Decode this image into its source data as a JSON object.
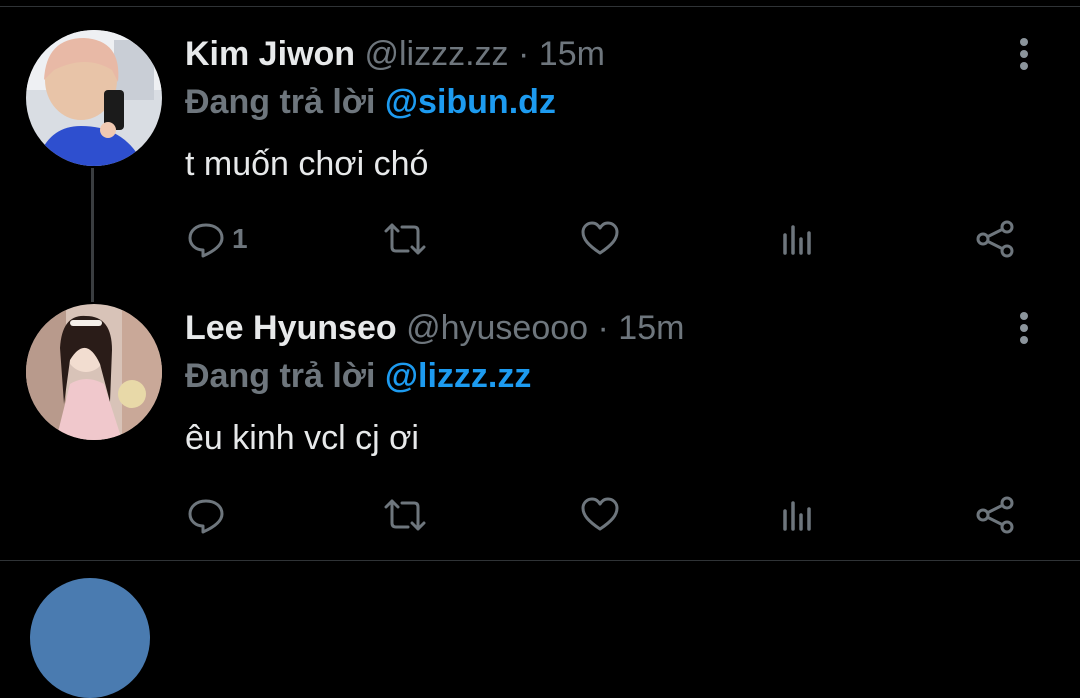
{
  "tweets": [
    {
      "name": "Kim Jiwon",
      "handle": "@lizzz.zz",
      "separator": "·",
      "time": "15m",
      "reply_label": "Đang trả lời",
      "reply_to": "@sibun.dz",
      "text": "t muốn chơi chó",
      "reply_count": "1",
      "icons": [
        "reply-icon",
        "retweet-icon",
        "like-icon",
        "stats-icon",
        "share-icon",
        "more-icon"
      ]
    },
    {
      "name": "Lee Hyunseo",
      "handle": "@hyuseooo",
      "separator": "·",
      "time": "15m",
      "reply_label": "Đang trả lời",
      "reply_to": "@lizzz.zz",
      "text": "êu kinh vcl cj ơi",
      "reply_count": "",
      "icons": [
        "reply-icon",
        "retweet-icon",
        "like-icon",
        "stats-icon",
        "share-icon",
        "more-icon"
      ]
    }
  ],
  "colors": {
    "background": "#000000",
    "name": "#e7e9ea",
    "secondary": "#6e767d",
    "mention": "#1d9bf0",
    "divider": "#2f3336"
  }
}
